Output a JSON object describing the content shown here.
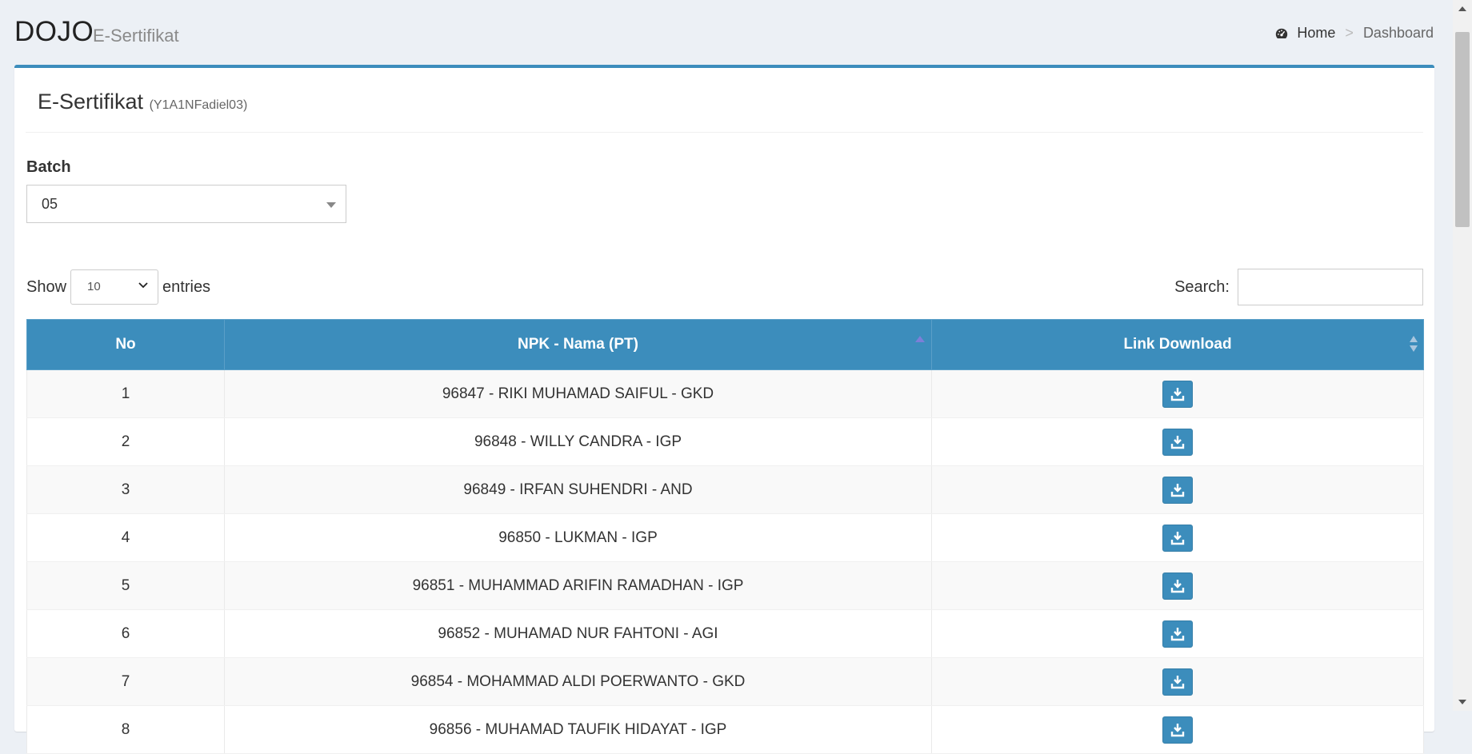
{
  "header": {
    "brand": "DOJO",
    "subtitle": "E-Sertifikat"
  },
  "breadcrumb": {
    "home": "Home",
    "separator": ">",
    "current": "Dashboard"
  },
  "box": {
    "title": "E-Sertifikat",
    "code": "(Y1A1NFadiel03)"
  },
  "batch": {
    "label": "Batch",
    "value": "05"
  },
  "length": {
    "show": "Show",
    "value": "10",
    "entries": "entries"
  },
  "search": {
    "label": "Search:",
    "value": ""
  },
  "table": {
    "columns": [
      "No",
      "NPK - Nama (PT)",
      "Link Download"
    ],
    "rows": [
      {
        "no": "1",
        "name": "96847 - RIKI MUHAMAD SAIFUL - GKD"
      },
      {
        "no": "2",
        "name": "96848 - WILLY CANDRA - IGP"
      },
      {
        "no": "3",
        "name": "96849 - IRFAN SUHENDRI - AND"
      },
      {
        "no": "4",
        "name": "96850 - LUKMAN - IGP"
      },
      {
        "no": "5",
        "name": "96851 - MUHAMMAD ARIFIN RAMADHAN - IGP"
      },
      {
        "no": "6",
        "name": "96852 - MUHAMAD NUR FAHTONI - AGI"
      },
      {
        "no": "7",
        "name": "96854 - MOHAMMAD ALDI POERWANTO - GKD"
      },
      {
        "no": "8",
        "name": "96856 - MUHAMAD TAUFIK HIDAYAT - IGP"
      }
    ]
  },
  "colors": {
    "primary": "#3c8dbc",
    "background": "#ecf0f5"
  },
  "icons": {
    "breadcrumb": "dashboard-gauge-icon",
    "download": "download-icon"
  }
}
